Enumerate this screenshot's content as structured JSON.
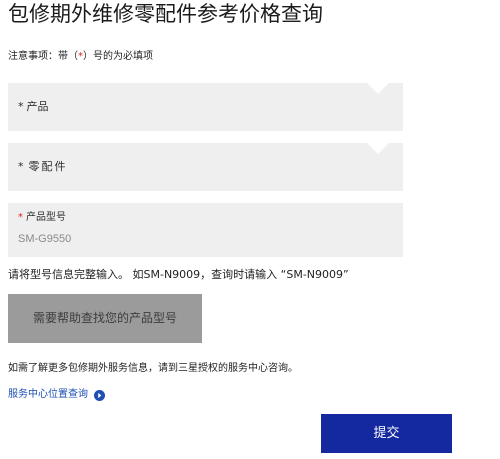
{
  "page": {
    "title": "包修期外维修零配件参考价格查询"
  },
  "notice": {
    "prefix": "注意事项：带（",
    "star": "*",
    "suffix": "）号的为必填项"
  },
  "form": {
    "product": {
      "required_mark": "*",
      "label": "产品"
    },
    "part": {
      "required_mark": "*",
      "label": "零配件"
    },
    "model": {
      "required_mark": "*",
      "label": "产品型号",
      "value": "SM-G9550"
    }
  },
  "hint": {
    "text": "请将型号信息完整输入。 如SM-N9009，查询时请输入 “SM-N9009”"
  },
  "help_button": {
    "label": "需要帮助查找您的产品型号"
  },
  "info": {
    "text": "如需了解更多包修期外服务信息，请到三星授权的服务中心咨询。"
  },
  "service_link": {
    "label": "服务中心位置查询",
    "icon": "circle-arrow-right-icon",
    "color": "#1e4fb4"
  },
  "submit_button": {
    "label": "提交",
    "color": "#1428a0"
  },
  "colors": {
    "field_background": "#efefef",
    "required_star": "#e2231a",
    "help_button_background": "#9b9b9b"
  }
}
